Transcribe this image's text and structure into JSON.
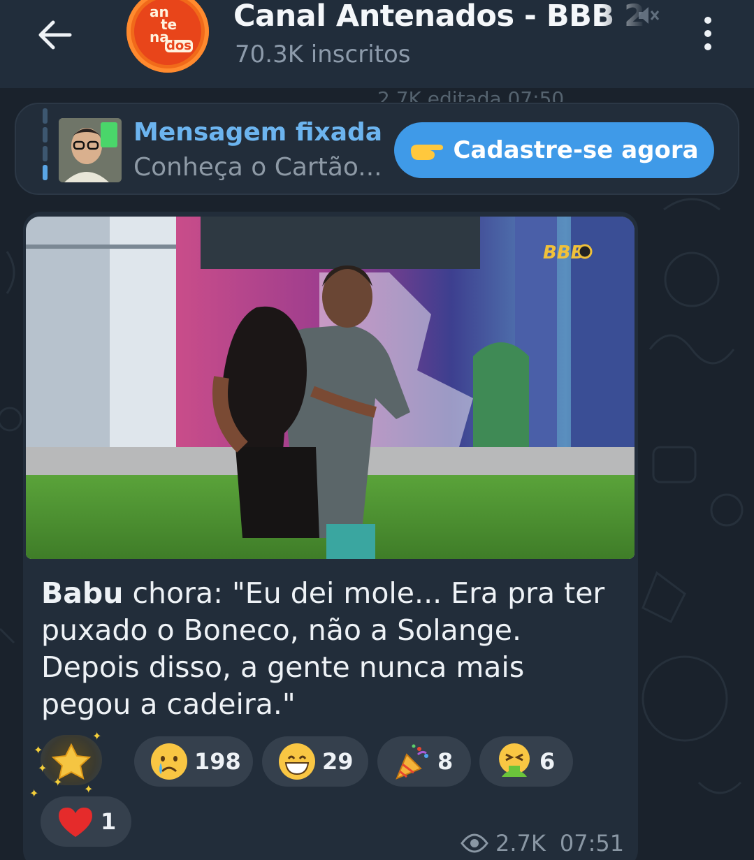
{
  "header": {
    "title": "Canal Antenados - BBB 2",
    "subtitle": "70.3K inscritos",
    "avatar_text": [
      "an",
      "te",
      "na",
      "dos"
    ]
  },
  "previous_meta": "2.7K  editada 07:50",
  "pinned": {
    "title": "Mensagem fixada",
    "text": "Conheça o Cartão...",
    "cta_label": "Cadastre-se agora"
  },
  "message": {
    "photo_watermark": "BBB",
    "bold_name": "Babu",
    "text": " chora: \"Eu dei mole... Era pra ter puxado o Boneco, não a Solange. Depois disso, a gente nunca mais pegou a cadeira.\"",
    "reactions": [
      {
        "emoji": "star",
        "count": ""
      },
      {
        "emoji": "crying-face",
        "count": "198"
      },
      {
        "emoji": "grinning-face",
        "count": "29"
      },
      {
        "emoji": "party-popper",
        "count": "8"
      },
      {
        "emoji": "vomiting-face",
        "count": "6"
      },
      {
        "emoji": "red-heart",
        "count": "1"
      }
    ],
    "views": "2.7K",
    "time": "07:51"
  },
  "colors": {
    "background": "#1a222c",
    "header": "#212d3b",
    "bubble": "#222d3a",
    "accent_blue": "#3f9ae8",
    "pinned_title": "#6cb4ef",
    "avatar_orange": "#f16a1a"
  }
}
